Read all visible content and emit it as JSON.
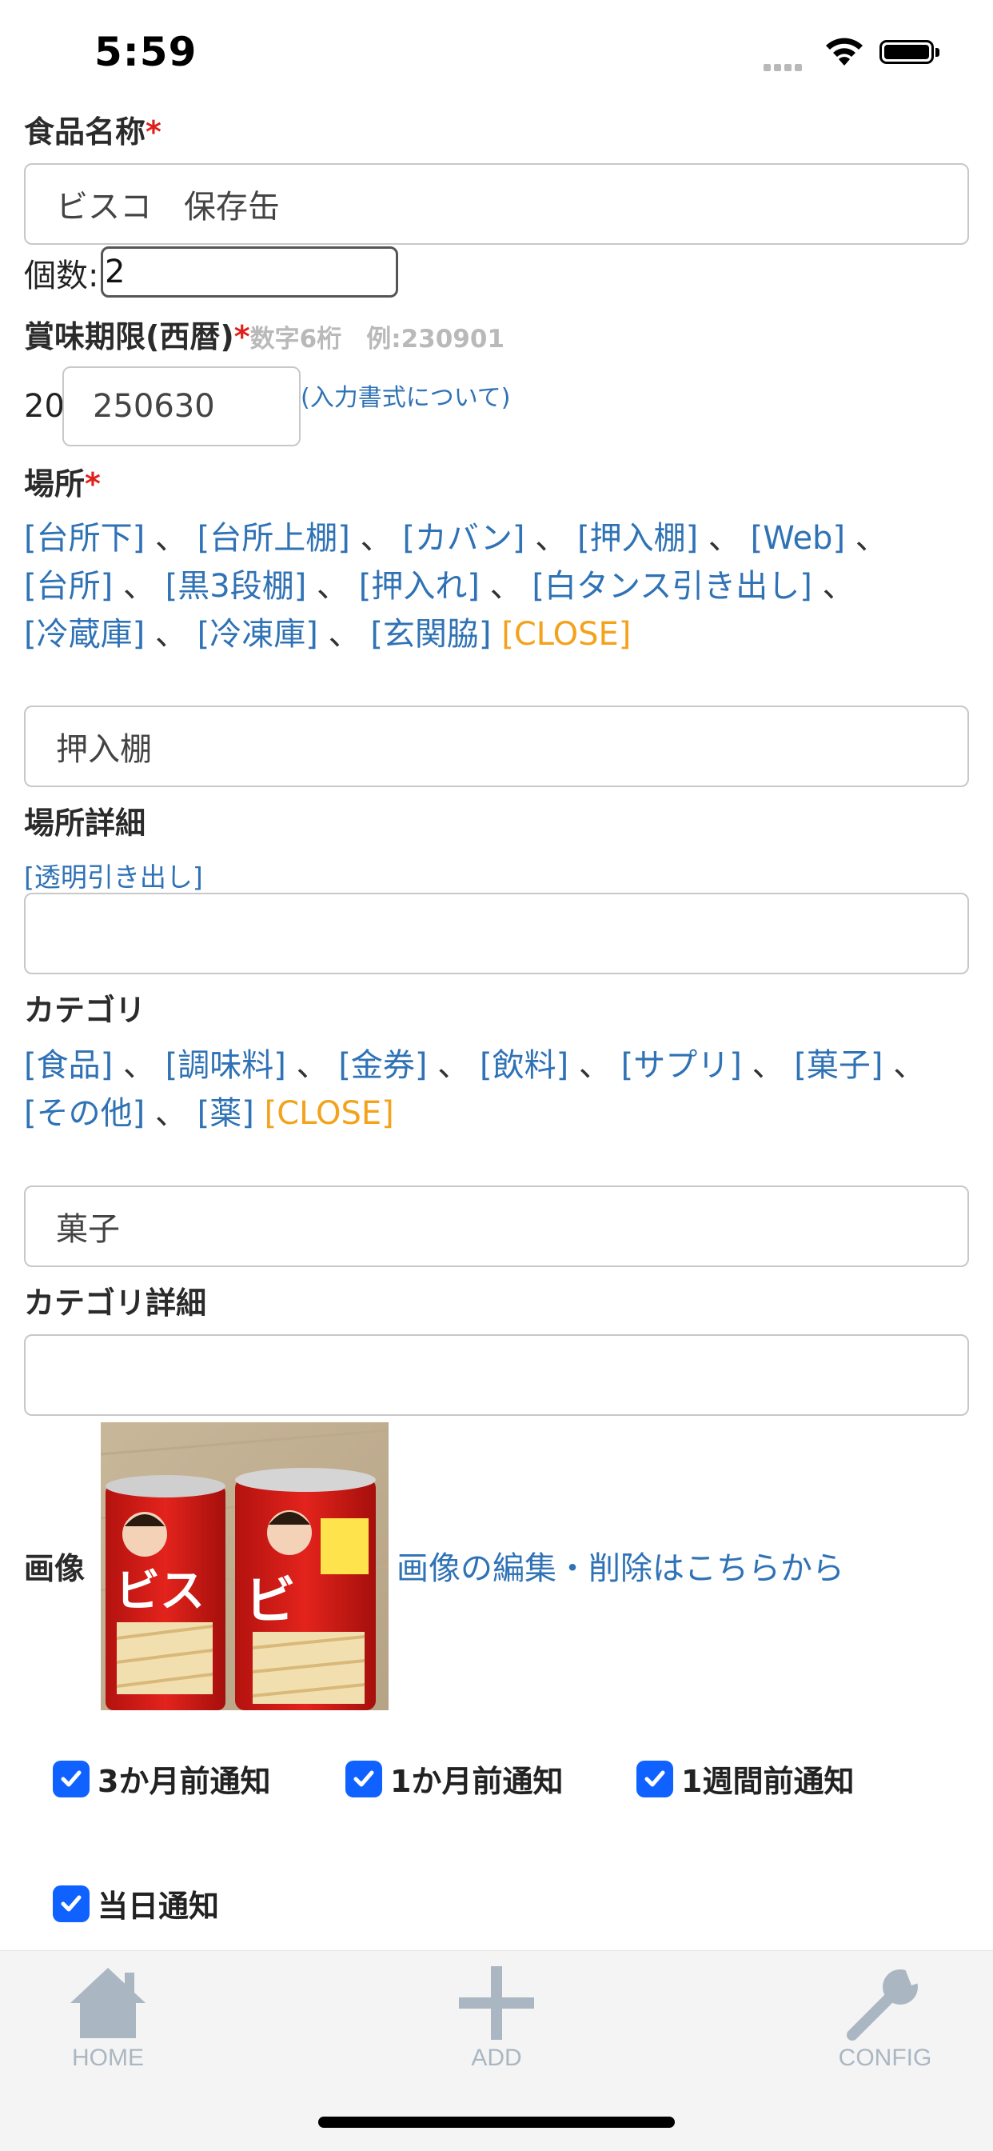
{
  "status_bar": {
    "time": "5:59"
  },
  "food_name": {
    "label": "食品名称",
    "required_mark": "*",
    "value": "ビスコ　保存缶"
  },
  "quantity": {
    "label": "個数:",
    "value": "2"
  },
  "expiry": {
    "label": "賞味期限(西暦)",
    "required_mark": "*",
    "hint": "数字6桁　例:230901",
    "prefix": "20",
    "value": "250630",
    "format_link": "(入力書式について)"
  },
  "location": {
    "label": "場所",
    "required_mark": "*",
    "options": [
      "[台所下]",
      "[台所上棚]",
      "[カバン]",
      "[押入棚]",
      "[Web]",
      "[台所]",
      "[黒3段棚]",
      "[押入れ]",
      "[白タンス引き出し]",
      "[冷蔵庫]",
      "[冷凍庫]",
      "[玄関脇]"
    ],
    "separator": "、",
    "close_label": "[CLOSE]",
    "value": "押入棚"
  },
  "location_detail": {
    "label": "場所詳細",
    "option": "[透明引き出し]",
    "value": ""
  },
  "category": {
    "label": "カテゴリ",
    "options": [
      "[食品]",
      "[調味料]",
      "[金券]",
      "[飲料]",
      "[サプリ]",
      "[菓子]",
      "[その他]",
      "[薬]"
    ],
    "separator": "、",
    "close_label": "[CLOSE]",
    "value": "菓子"
  },
  "category_detail": {
    "label": "カテゴリ詳細",
    "value": ""
  },
  "image": {
    "label": "画像",
    "edit_link": "画像の編集・削除はこちらから"
  },
  "notifications": [
    {
      "label": "3か月前通知",
      "checked": true
    },
    {
      "label": "1か月前通知",
      "checked": true
    },
    {
      "label": "1週間前通知",
      "checked": true
    },
    {
      "label": "当日通知",
      "checked": true
    }
  ],
  "tab_bar": {
    "home": "HOME",
    "add": "ADD",
    "config": "CONFIG"
  },
  "colors": {
    "link": "#2f72b5",
    "close": "#f3a21b",
    "required": "#e0201a",
    "checkbox": "#0f62ff"
  }
}
